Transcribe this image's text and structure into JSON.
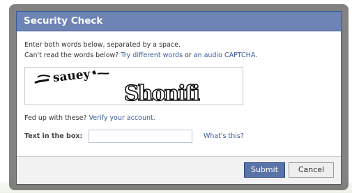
{
  "dialog": {
    "title": "Security Check",
    "instructions_line1": "Enter both words below, separated by a space.",
    "instructions_line2_prefix": "Can't read the words below? ",
    "try_different_words_link": "Try different words",
    "or_text": " or ",
    "audio_captcha_link": "an audio CAPTCHA",
    "period": ".",
    "captcha_word_1": "sauey",
    "captcha_word_2": "Shonifi",
    "fed_up_prefix": "Fed up with these? ",
    "verify_account_link": "Verify your account.",
    "text_box_label": "Text in the box:",
    "text_box_value": "",
    "whats_this_link": "What's this?",
    "submit_label": "Submit",
    "cancel_label": "Cancel"
  },
  "colors": {
    "titlebar": "#6d84b4",
    "link": "#3b5998",
    "submit_bg": "#5b74a8"
  }
}
